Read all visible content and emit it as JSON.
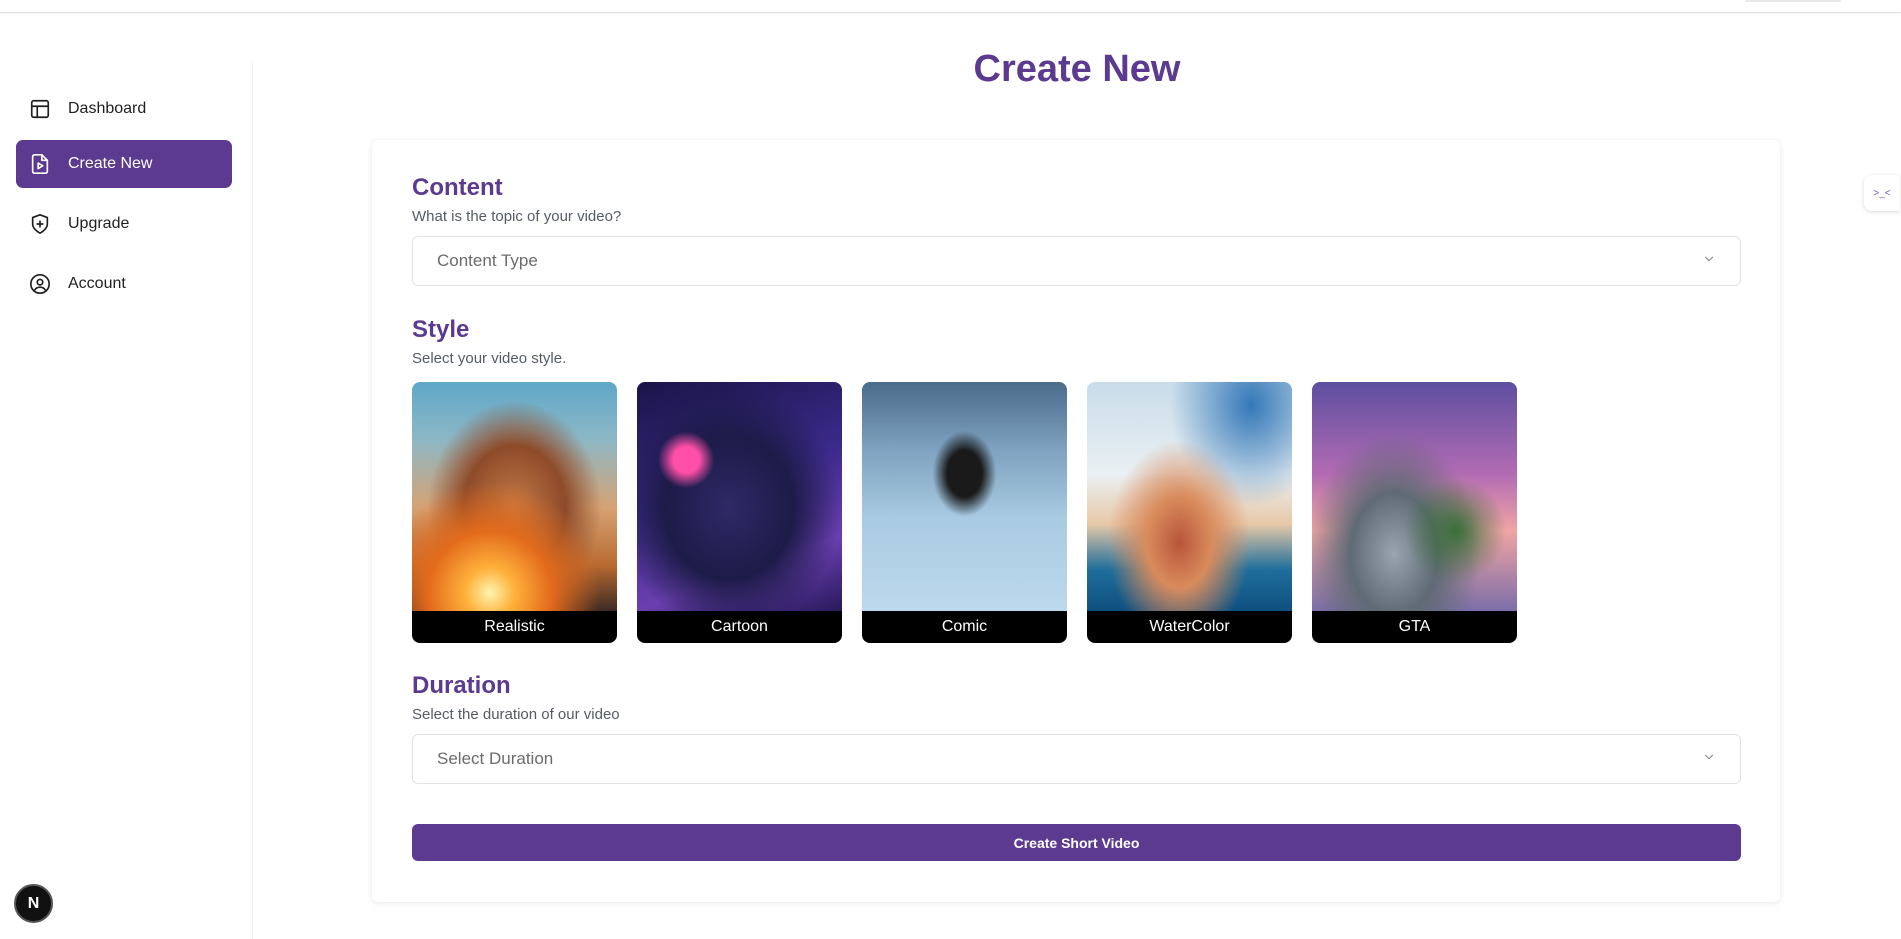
{
  "page": {
    "title": "Create New"
  },
  "sidebar": {
    "items": [
      {
        "label": "Dashboard",
        "icon": "layout-dashboard-icon",
        "active": false
      },
      {
        "label": "Create New",
        "icon": "file-video-icon",
        "active": true
      },
      {
        "label": "Upgrade",
        "icon": "shield-plus-icon",
        "active": false
      },
      {
        "label": "Account",
        "icon": "user-circle-icon",
        "active": false
      }
    ]
  },
  "form": {
    "content": {
      "title": "Content",
      "description": "What is the topic of your video?",
      "select_placeholder": "Content Type"
    },
    "style": {
      "title": "Style",
      "description": "Select your video style.",
      "options": [
        {
          "label": "Realistic"
        },
        {
          "label": "Cartoon"
        },
        {
          "label": "Comic"
        },
        {
          "label": "WaterColor"
        },
        {
          "label": "GTA"
        }
      ]
    },
    "duration": {
      "title": "Duration",
      "description": "Select the duration of our video",
      "select_placeholder": "Select Duration"
    },
    "submit_label": "Create Short Video"
  },
  "badge": {
    "letter": "N"
  },
  "widget": {
    "glyph": ">_<"
  },
  "colors": {
    "accent": "#5b3a8f",
    "border": "#e2e2e2"
  }
}
